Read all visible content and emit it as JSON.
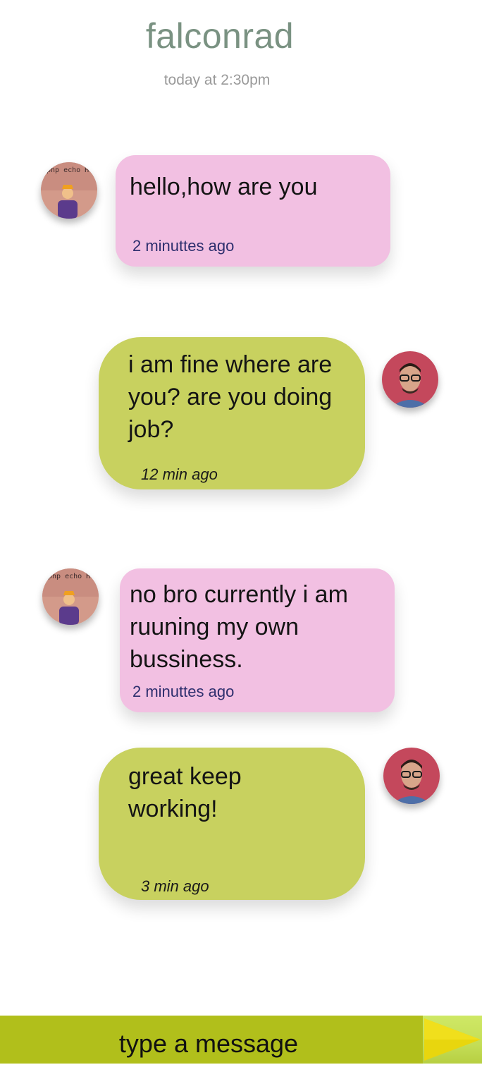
{
  "header": {
    "title": "falconrad",
    "timestamp": "today at 2:30pm"
  },
  "messages": [
    {
      "sender": "other",
      "text": "hello,how are you",
      "time": "2 minuttes ago",
      "avatar_text": "php echo Hello World!"
    },
    {
      "sender": "me",
      "text": "i am fine where are you? are you doing job?",
      "time": "12 min ago"
    },
    {
      "sender": "other",
      "text": "no bro currently i am ruuning my own bussiness.",
      "time": "2 minuttes ago",
      "avatar_text": "php echo Hello World!"
    },
    {
      "sender": "me",
      "text": "great keep working!",
      "time": "3 min ago"
    }
  ],
  "composer": {
    "placeholder": "type a message",
    "send_icon": "send-arrow-icon"
  },
  "colors": {
    "title": "#7a9282",
    "incoming_bubble": "#f2c0e2",
    "outgoing_bubble": "#c8d15f",
    "composer_bar": "#b1bf1b",
    "send_arrow": "#e8d60e"
  }
}
